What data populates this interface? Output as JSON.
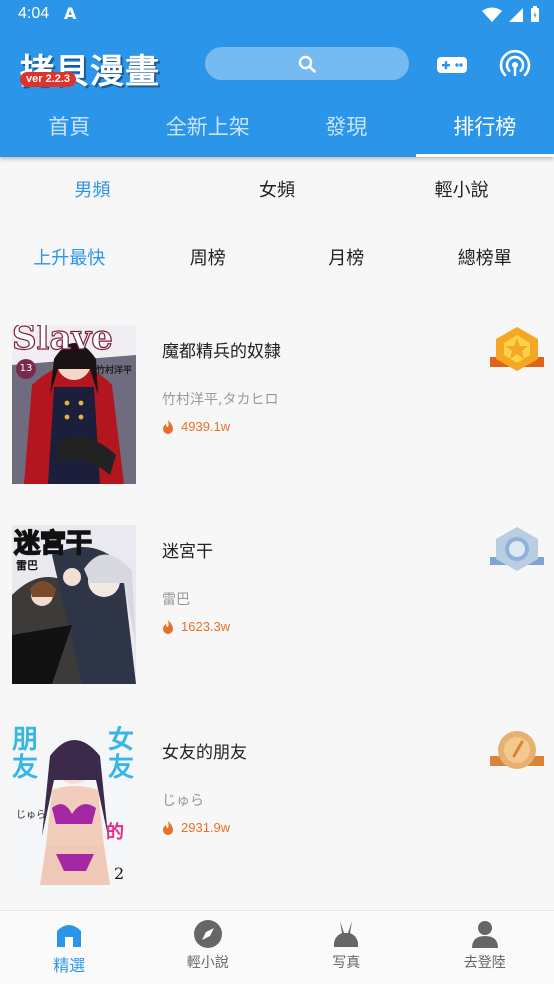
{
  "status": {
    "time": "4:04",
    "app_icon_letter": "A"
  },
  "header": {
    "logo": "拷貝漫畫",
    "version": "ver 2.2.3",
    "search_icon": "search-icon",
    "game_icon": "gamepad-icon",
    "broadcast_icon": "broadcast-icon"
  },
  "tabs": [
    "首頁",
    "全新上架",
    "發現",
    "排行榜"
  ],
  "active_tab": 3,
  "gender_tabs": [
    "男頻",
    "女頻",
    "輕小說"
  ],
  "period_tabs": [
    "上升最快",
    "周榜",
    "月榜",
    "總榜單"
  ],
  "ranking": [
    {
      "rank": 1,
      "title": "魔都精兵的奴隸",
      "author": "竹村洋平,タカヒロ",
      "heat": "4939.1w",
      "medal": "gold",
      "cover_text_top": "Slave",
      "cover_badge": "13",
      "cover_text_side": "竹村洋平"
    },
    {
      "rank": 2,
      "title": "迷宮干",
      "author": "雷巴",
      "heat": "1623.3w",
      "medal": "silver",
      "cover_text_top": "迷宮干",
      "cover_text_side": "雷巴"
    },
    {
      "rank": 3,
      "title": "女友的朋友",
      "author": "じゅら",
      "heat": "2931.9w",
      "medal": "bronze",
      "cover_text_left": "朋友",
      "cover_text_right": "女友",
      "cover_text_small": "じゅら",
      "cover_de": "的",
      "cover_num": "2"
    }
  ],
  "colors": {
    "primary": "#2b95ea",
    "heat": "#e8702a",
    "gold": "#f5a623",
    "silver": "#8fb2d6",
    "bronze": "#e0a05a"
  },
  "bottom_nav": [
    {
      "label": "精選",
      "icon": "home-icon"
    },
    {
      "label": "輕小說",
      "icon": "compass-icon"
    },
    {
      "label": "写真",
      "icon": "bunny-icon"
    },
    {
      "label": "去登陸",
      "icon": "user-icon"
    }
  ]
}
